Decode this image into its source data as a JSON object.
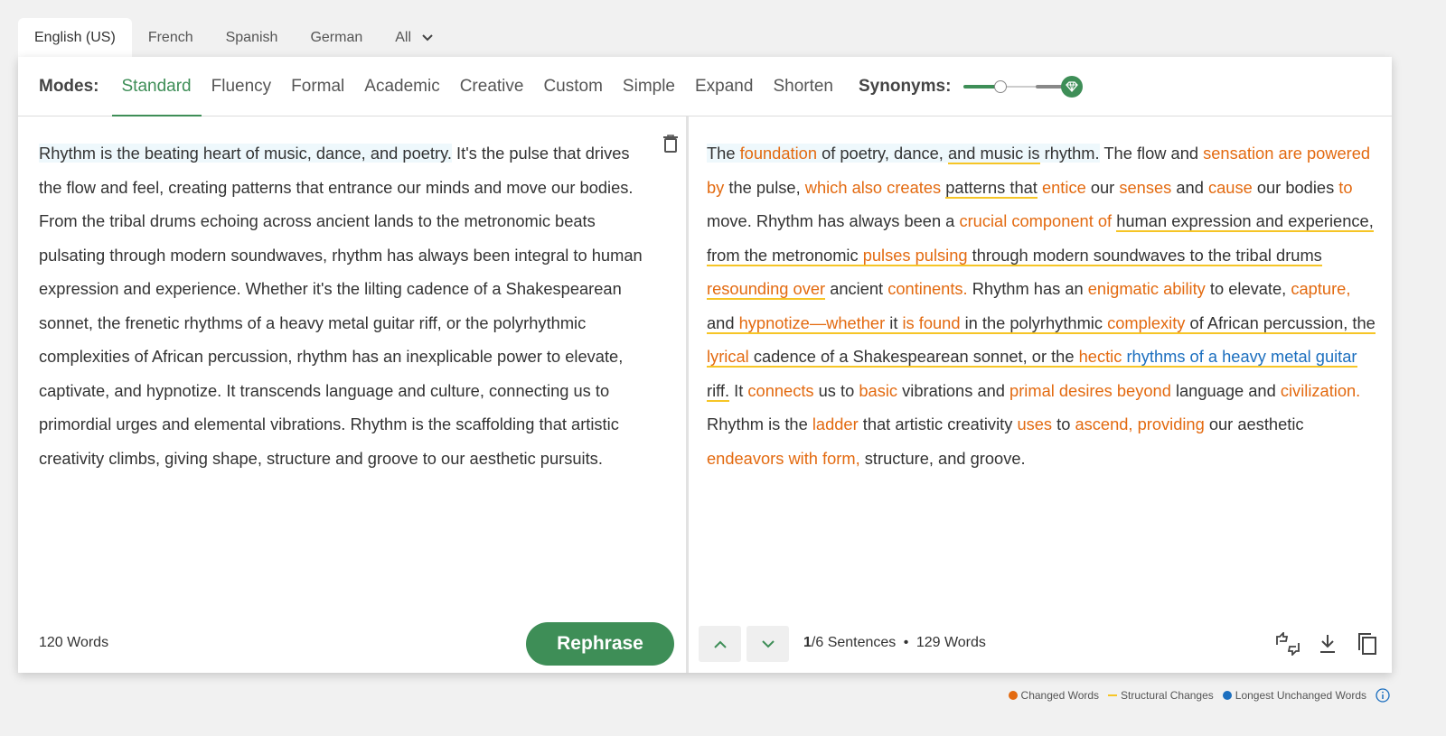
{
  "language_tabs": [
    {
      "label": "English (US)",
      "active": true
    },
    {
      "label": "French",
      "active": false
    },
    {
      "label": "Spanish",
      "active": false
    },
    {
      "label": "German",
      "active": false
    },
    {
      "label": "All",
      "active": false
    }
  ],
  "modes": {
    "label": "Modes:",
    "items": [
      "Standard",
      "Fluency",
      "Formal",
      "Academic",
      "Creative",
      "Custom",
      "Simple",
      "Expand",
      "Shorten"
    ],
    "active": "Standard"
  },
  "synonyms": {
    "label": "Synonyms:",
    "level": 0.33
  },
  "input": {
    "highlighted_sentence": "Rhythm is the beating heart of music, dance, and poetry.",
    "text": " It's the pulse that drives the flow and feel, creating patterns that entrance our minds and move our bodies. From the tribal drums echoing across ancient lands to the metronomic beats pulsating through modern soundwaves, rhythm has always been integral to human expression and experience. Whether it's the lilting cadence of a Shakespearean sonnet, the frenetic rhythms of a heavy metal guitar riff, or the polyrhythmic complexities of African percussion, rhythm has an inexplicable power to elevate, captivate, and hypnotize. It transcends language and culture, connecting us to primordial urges and elemental vibrations. Rhythm is the scaffolding that artistic creativity climbs, giving shape, structure and groove to our aesthetic pursuits.",
    "word_count": "120 Words",
    "rephrase_label": "Rephrase"
  },
  "output": {
    "segments": [
      {
        "t": "The ",
        "c": "hl"
      },
      {
        "t": "foundation",
        "c": "hl ch"
      },
      {
        "t": " of poetry, dance, ",
        "c": "hl"
      },
      {
        "t": "and music is",
        "c": "hl st"
      },
      {
        "t": " rhythm.",
        "c": "hl"
      },
      {
        "t": " The flow and ",
        "c": ""
      },
      {
        "t": "sensation are powered by",
        "c": "ch"
      },
      {
        "t": " the pulse, ",
        "c": ""
      },
      {
        "t": "which also creates",
        "c": "ch"
      },
      {
        "t": " ",
        "c": ""
      },
      {
        "t": "patterns that",
        "c": "st"
      },
      {
        "t": " ",
        "c": ""
      },
      {
        "t": "entice",
        "c": "ch"
      },
      {
        "t": " our ",
        "c": ""
      },
      {
        "t": "senses",
        "c": "ch"
      },
      {
        "t": " and ",
        "c": ""
      },
      {
        "t": "cause",
        "c": "ch"
      },
      {
        "t": " our bodies ",
        "c": ""
      },
      {
        "t": "to",
        "c": "ch"
      },
      {
        "t": " move. Rhythm has always been a ",
        "c": ""
      },
      {
        "t": "crucial component of",
        "c": "ch"
      },
      {
        "t": " ",
        "c": ""
      },
      {
        "t": "human expression and experience",
        "c": "st"
      },
      {
        "t": ", from the metronomic ",
        "c": "st"
      },
      {
        "t": "pulses pulsing",
        "c": "st ch"
      },
      {
        "t": " through modern soundwaves to the tribal drums ",
        "c": "st"
      },
      {
        "t": "resounding over",
        "c": "st ch"
      },
      {
        "t": " ancient ",
        "c": ""
      },
      {
        "t": "continents.",
        "c": "ch"
      },
      {
        "t": " Rhythm has an ",
        "c": ""
      },
      {
        "t": "enigmatic ability",
        "c": "ch"
      },
      {
        "t": " to elevate, ",
        "c": ""
      },
      {
        "t": "capture,",
        "c": "ch"
      },
      {
        "t": " ",
        "c": ""
      },
      {
        "t": "and ",
        "c": "st"
      },
      {
        "t": "hypnotize—whether",
        "c": "st ch"
      },
      {
        "t": " it ",
        "c": "st"
      },
      {
        "t": "is found",
        "c": "st ch"
      },
      {
        "t": " in the polyrhythmic ",
        "c": "st"
      },
      {
        "t": "complexity",
        "c": "st ch"
      },
      {
        "t": " of African percussion, the ",
        "c": "st"
      },
      {
        "t": "lyrical",
        "c": "st ch"
      },
      {
        "t": " cadence of a Shakespearean sonnet, or the ",
        "c": "st"
      },
      {
        "t": "hectic",
        "c": "st ch"
      },
      {
        "t": " ",
        "c": "st"
      },
      {
        "t": "rhythms of a heavy metal guitar",
        "c": "st lu"
      },
      {
        "t": " riff.",
        "c": "st"
      },
      {
        "t": " It ",
        "c": ""
      },
      {
        "t": "connects",
        "c": "ch"
      },
      {
        "t": " us to ",
        "c": ""
      },
      {
        "t": "basic",
        "c": "ch"
      },
      {
        "t": " vibrations and ",
        "c": ""
      },
      {
        "t": "primal desires beyond",
        "c": "ch"
      },
      {
        "t": " language and ",
        "c": ""
      },
      {
        "t": "civilization.",
        "c": "ch"
      },
      {
        "t": " Rhythm is the ",
        "c": ""
      },
      {
        "t": "ladder",
        "c": "ch"
      },
      {
        "t": " that artistic creativity ",
        "c": ""
      },
      {
        "t": "uses",
        "c": "ch"
      },
      {
        "t": " to ",
        "c": ""
      },
      {
        "t": "ascend, providing",
        "c": "ch"
      },
      {
        "t": " our aesthetic ",
        "c": ""
      },
      {
        "t": "endeavors with form,",
        "c": "ch"
      },
      {
        "t": " structure, and groove.",
        "c": ""
      }
    ],
    "sentence_current": "1",
    "sentence_total": "/6 Sentences",
    "separator": "•",
    "word_count": "129 Words"
  },
  "legend": {
    "changed": {
      "label": "Changed Words",
      "color": "#e36a10"
    },
    "structural": {
      "label": "Structural Changes",
      "color": "#f6c526"
    },
    "unchanged": {
      "label": "Longest Unchanged Words",
      "color": "#1c6fbf"
    }
  },
  "colors": {
    "accent": "#3e8e57"
  },
  "icons": [
    "chevron-down-icon",
    "trash-icon",
    "diamond-icon",
    "arrow-up-icon",
    "arrow-down-icon",
    "rate-icon",
    "download-icon",
    "copy-icon",
    "info-icon"
  ]
}
